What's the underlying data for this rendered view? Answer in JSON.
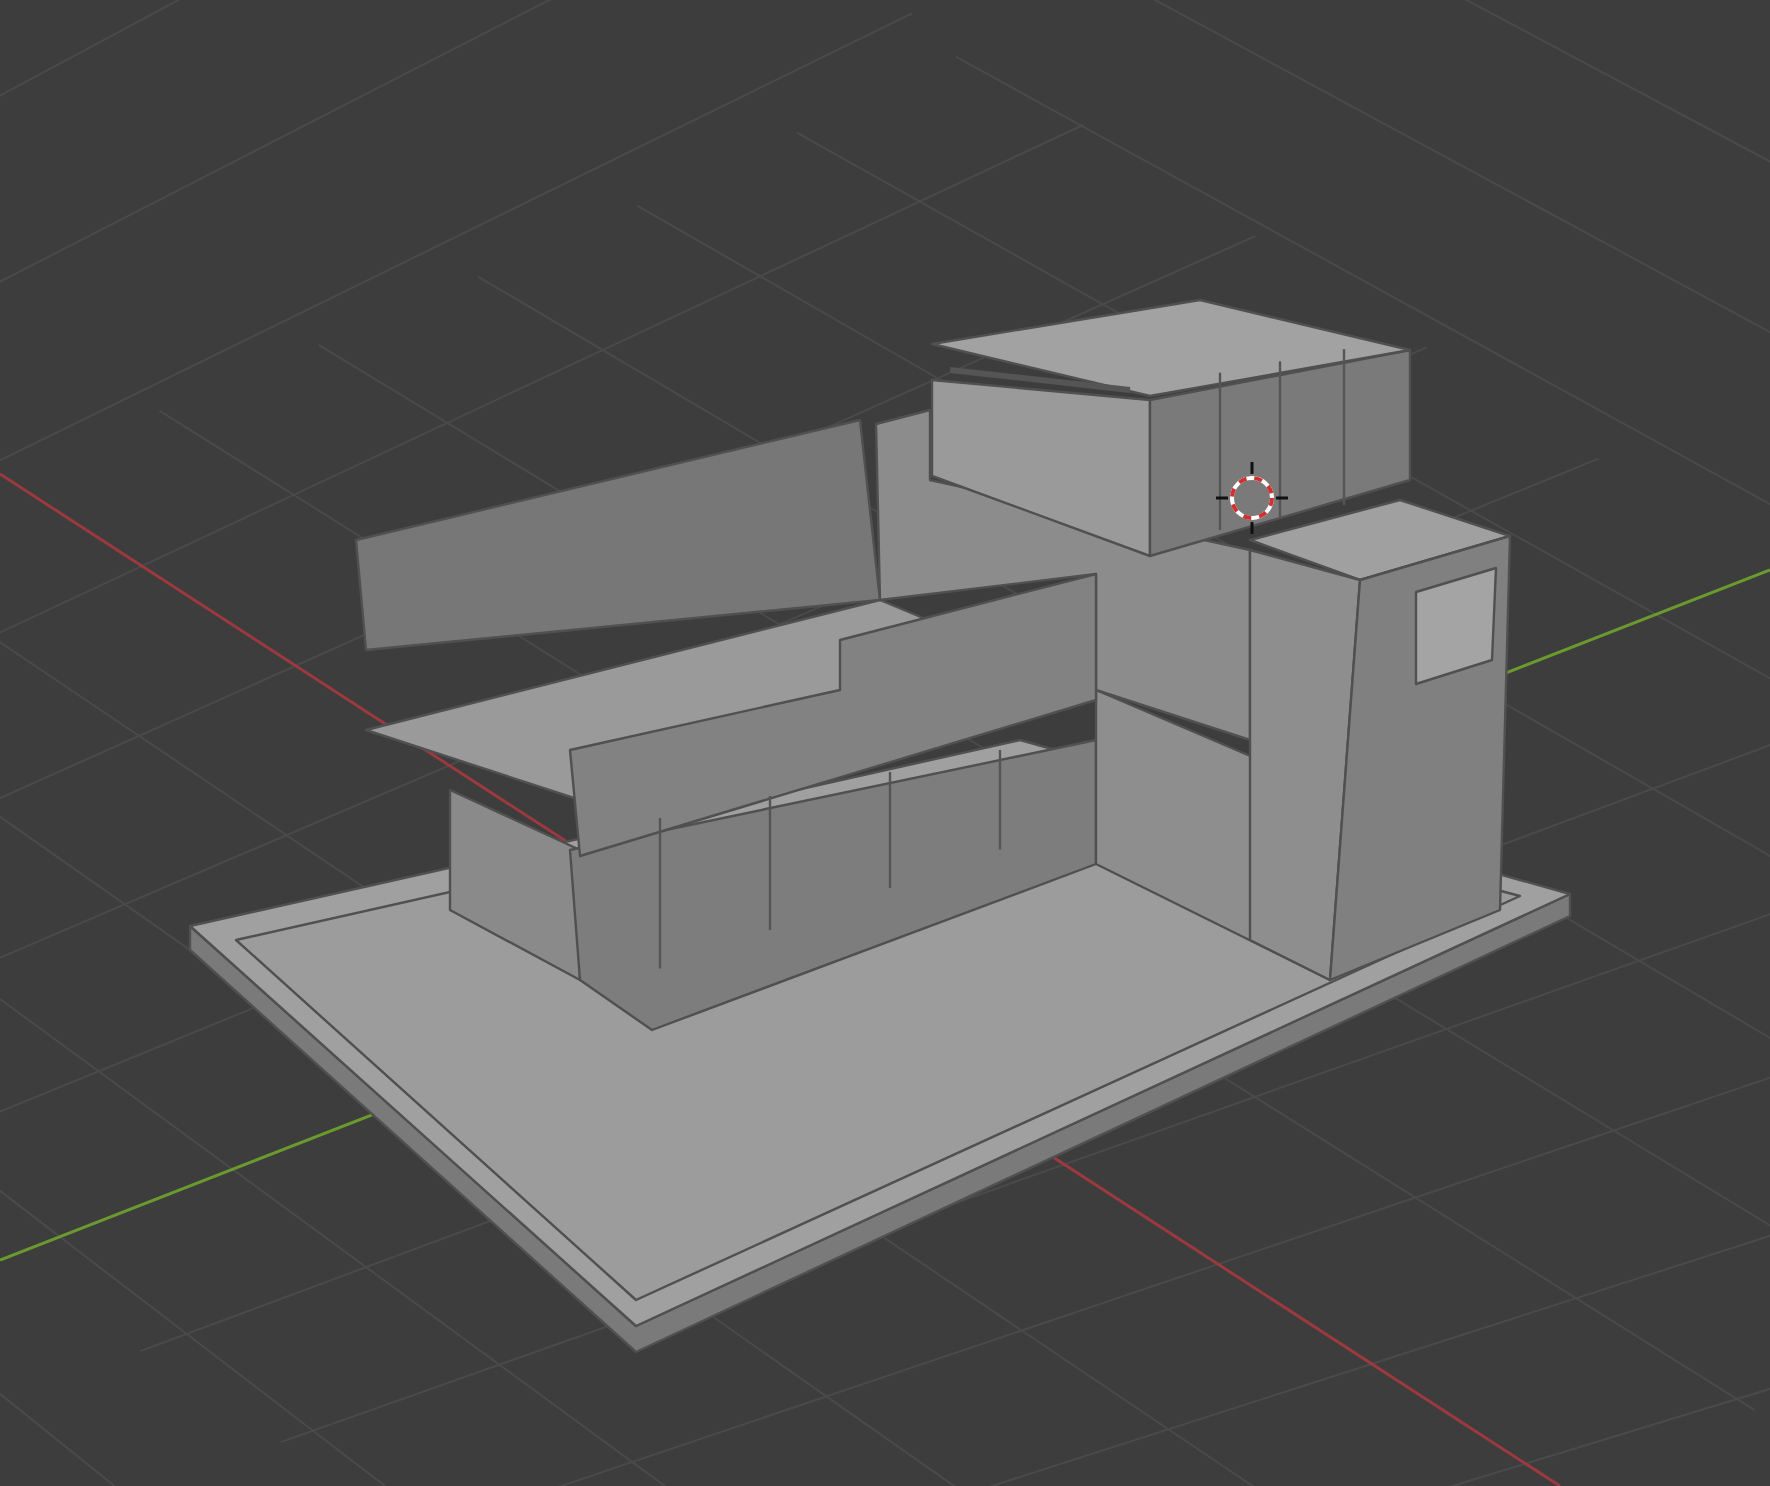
{
  "viewport": {
    "grid": {
      "visible": true
    },
    "axes": {
      "visible": true
    },
    "cursor_3d": {
      "visible": true
    },
    "model": {
      "visible": true
    }
  }
}
